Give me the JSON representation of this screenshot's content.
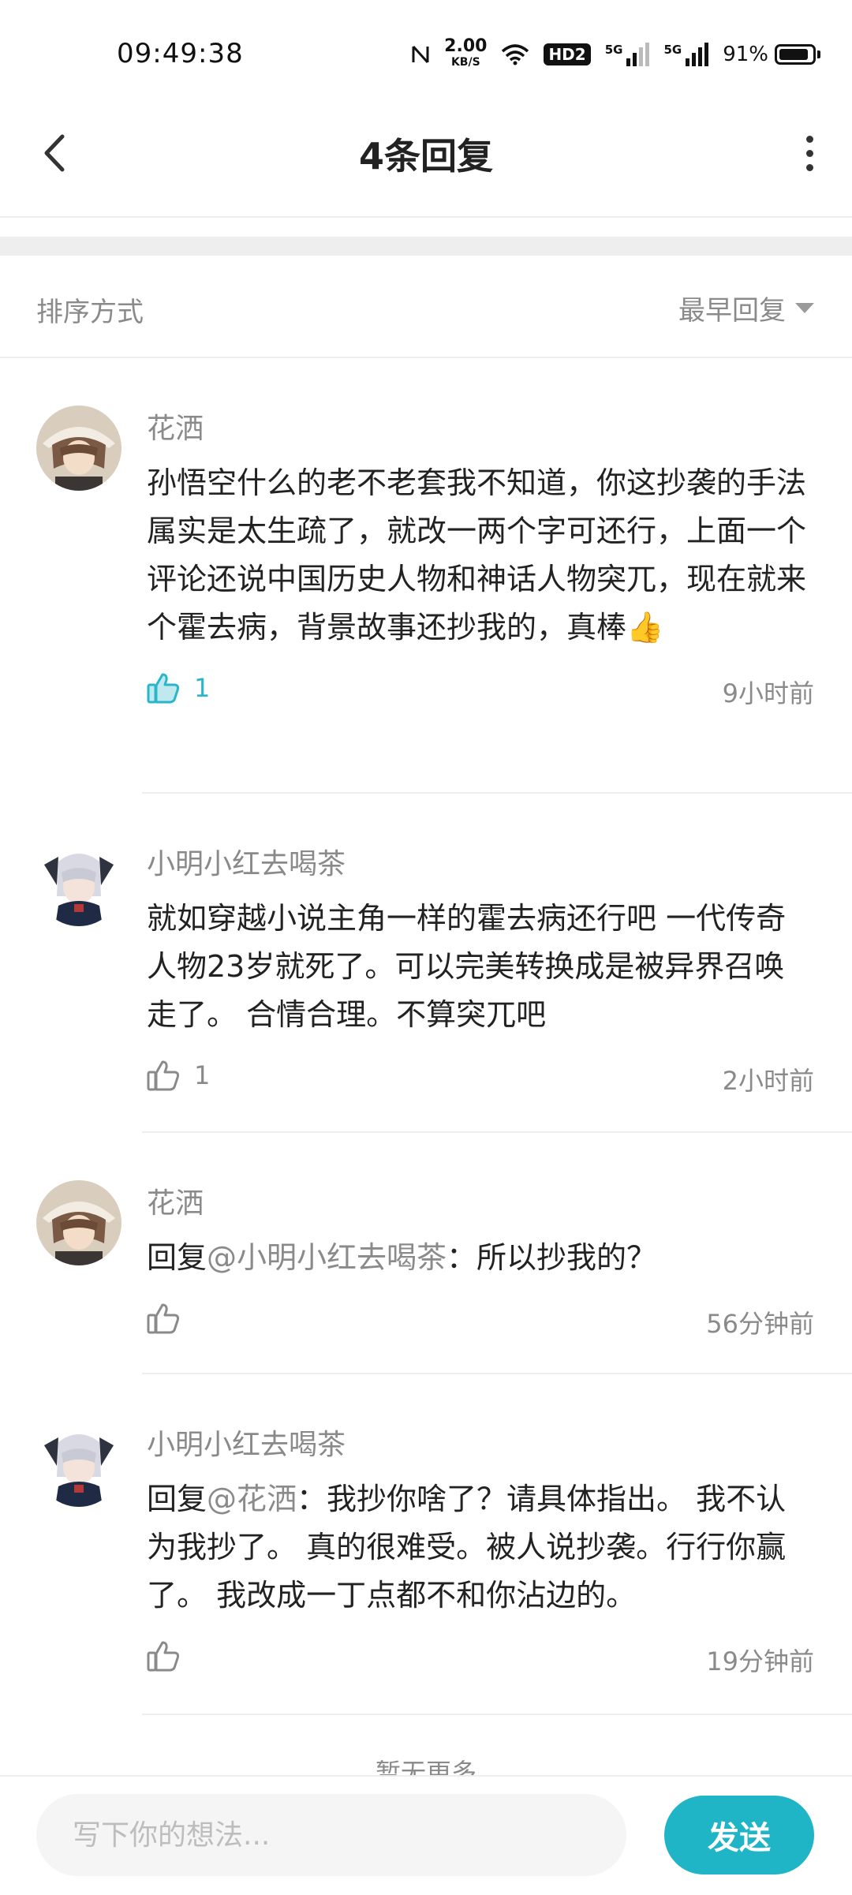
{
  "status_bar": {
    "time": "09:49:38",
    "net_speed_value": "2.00",
    "net_speed_unit": "KB/S",
    "hd_label": "HD2",
    "sim1_label": "5G",
    "sim2_label": "5G",
    "battery_percent": "91%",
    "battery_level": 0.91
  },
  "header": {
    "title": "4条回复"
  },
  "sort": {
    "label": "排序方式",
    "selected": "最早回复"
  },
  "comments": [
    {
      "author": "花洒",
      "text": "孙悟空什么的老不老套我不知道，你这抄袭的手法属实是太生疏了，就改一两个字可还行，上面一个评论还说中国历史人物和神话人物突兀，现在就来个霍去病，背景故事还抄我的，真棒👍",
      "likes": "1",
      "liked": true,
      "time": "9小时前"
    },
    {
      "author": "小明小红去喝茶",
      "text": "就如穿越小说主角一样的霍去病还行吧 一代传奇人物23岁就死了。可以完美转换成是被异界召唤走了。 合情合理。不算突兀吧",
      "likes": "1",
      "liked": false,
      "time": "2小时前"
    },
    {
      "author": "花洒",
      "reply_prefix": "回复",
      "mention": "@小明小红去喝茶",
      "text": "：所以抄我的？",
      "likes": "",
      "liked": false,
      "time": "56分钟前"
    },
    {
      "author": "小明小红去喝茶",
      "reply_prefix": "回复",
      "mention": "@花洒",
      "text": "：我抄你啥了？请具体指出。 我不认为我抄了。 真的很难受。被人说抄袭。行行你赢了。 我改成一丁点都不和你沾边的。",
      "likes": "",
      "liked": false,
      "time": "19分钟前"
    }
  ],
  "end_text": "暂无更多",
  "composer": {
    "placeholder": "写下你的想法...",
    "send_label": "发送"
  },
  "colors": {
    "accent": "#1fb4c6",
    "like_active": "#29b6c9",
    "muted_text": "#8a8a8a"
  }
}
